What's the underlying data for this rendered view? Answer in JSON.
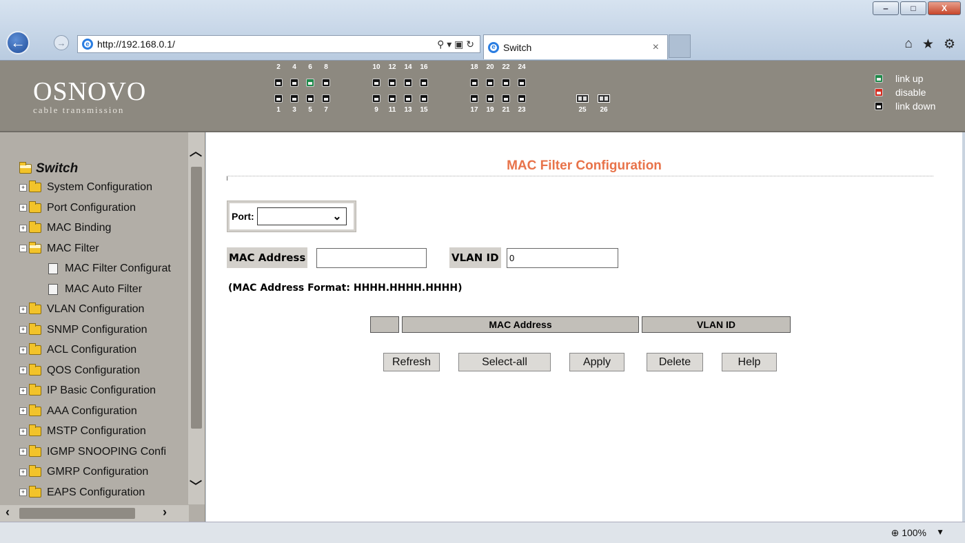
{
  "browser": {
    "url": "http://192.168.0.1/",
    "tab_title": "Switch",
    "tab_close": "×",
    "back_glyph": "←",
    "forward_glyph": "→",
    "address_tools": "⚲ ▾ ▣ ↻",
    "home_glyph": "⌂",
    "star_glyph": "★",
    "gear_glyph": "⚙",
    "minimize_glyph": "‒",
    "maximize_glyph": "□",
    "close_glyph": "X"
  },
  "brand": {
    "name": "OSNOVO",
    "tagline": "cable transmission"
  },
  "ports": {
    "top_labels": [
      "2",
      "4",
      "6",
      "8",
      "10",
      "12",
      "14",
      "16",
      "18",
      "20",
      "22",
      "24"
    ],
    "bottom_labels": [
      "1",
      "3",
      "5",
      "7",
      "9",
      "11",
      "13",
      "15",
      "17",
      "19",
      "21",
      "23"
    ],
    "sfp_labels": [
      "25",
      "26"
    ],
    "link_up_ports": [
      "6"
    ]
  },
  "legend": {
    "link_up": "link up",
    "disable": "disable",
    "link_down": "link down"
  },
  "colors": {
    "link_up": "#1f8a4a",
    "disable": "#d62b1f",
    "link_down": "#111111",
    "title": "#e8734a"
  },
  "sidebar": {
    "root": "Switch",
    "items": [
      {
        "label": "System Configuration",
        "state": "collapsed"
      },
      {
        "label": "Port Configuration",
        "state": "collapsed"
      },
      {
        "label": "MAC Binding",
        "state": "collapsed"
      },
      {
        "label": "MAC Filter",
        "state": "expanded"
      },
      {
        "label": "MAC Filter Configurat",
        "state": "child"
      },
      {
        "label": "MAC Auto Filter",
        "state": "child"
      },
      {
        "label": "VLAN Configuration",
        "state": "collapsed"
      },
      {
        "label": "SNMP Configuration",
        "state": "collapsed"
      },
      {
        "label": "ACL Configuration",
        "state": "collapsed"
      },
      {
        "label": "QOS Configuration",
        "state": "collapsed"
      },
      {
        "label": "IP Basic Configuration",
        "state": "collapsed"
      },
      {
        "label": "AAA Configuration",
        "state": "collapsed"
      },
      {
        "label": "MSTP Configuration",
        "state": "collapsed"
      },
      {
        "label": "IGMP SNOOPING Confi",
        "state": "collapsed"
      },
      {
        "label": "GMRP Configuration",
        "state": "collapsed"
      },
      {
        "label": "EAPS Configuration",
        "state": "collapsed"
      }
    ]
  },
  "main": {
    "title": "MAC Filter Configuration",
    "port_label": "Port:",
    "port_value": "",
    "mac_label": "MAC Address",
    "mac_value": "",
    "vlan_label": "VLAN ID",
    "vlan_value": "0",
    "format_note": "(MAC Address Format: HHHH.HHHH.HHHH)",
    "table_headers": [
      "",
      "MAC Address",
      "VLAN ID"
    ],
    "buttons": [
      "Refresh",
      "Select-all",
      "Apply",
      "Delete",
      "Help"
    ]
  },
  "status": {
    "zoom": "100%"
  }
}
